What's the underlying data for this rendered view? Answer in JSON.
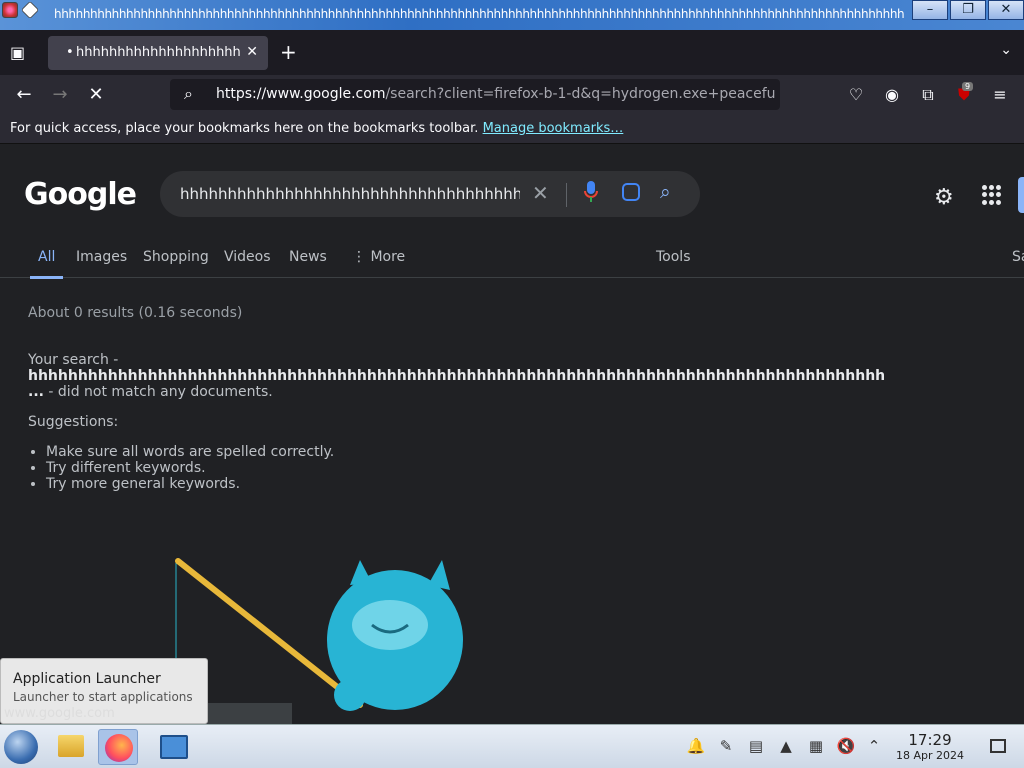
{
  "window": {
    "title": "hhhhhhhhhhhhhhhhhhhhhhhhhhhhhhhhhhhhhhhhhhhhhhhhhhhhhhhhhhhhhhhhhhhhhhhhhhhhhhhhhhhhhhhhhhhhhhhhhhhhhhhhhhhhhhhhhhhhhh",
    "minimize": "–",
    "restore": "❐",
    "close": "✕"
  },
  "browser": {
    "tab_title": "hhhhhhhhhhhhhhhhhhhhhh",
    "url_domain": "https://www.google.com",
    "url_rest": "/search?client=firefox-b-1-d&q=hydrogen.exe+peacefu",
    "extension_badge": "9",
    "bookmarks_text": "For quick access, place your bookmarks here on the bookmarks toolbar.",
    "bookmarks_link": "Manage bookmarks…"
  },
  "google": {
    "logo": "Google",
    "query": "hhhhhhhhhhhhhhhhhhhhhhhhhhhhhhhhhhhhhhhh",
    "tabs": [
      "All",
      "Images",
      "Shopping",
      "Videos",
      "News",
      "⋮ More"
    ],
    "tools": "Tools",
    "safesearch_partial": "Sa",
    "stats": "About 0 results (0.16 seconds)",
    "msg_prefix": "Your search -",
    "msg_term": "hhhhhhhhhhhhhhhhhhhhhhhhhhhhhhhhhhhhhhhhhhhhhhhhhhhhhhhhhhhhhhhhhhhhhhhhhhhhhhhhhhhhhh ...",
    "msg_suffix": "- did not match any documents.",
    "suggestions_title": "Suggestions:",
    "suggestions": [
      "Make sure all words are spelled correctly.",
      "Try different keywords.",
      "Try more general keywords."
    ]
  },
  "tooltip": {
    "title": "Application Launcher",
    "subtitle": "Launcher to start applications"
  },
  "status_url": "www.google.com",
  "taskbar": {
    "time": "17:29",
    "date": "18 Apr 2024"
  }
}
